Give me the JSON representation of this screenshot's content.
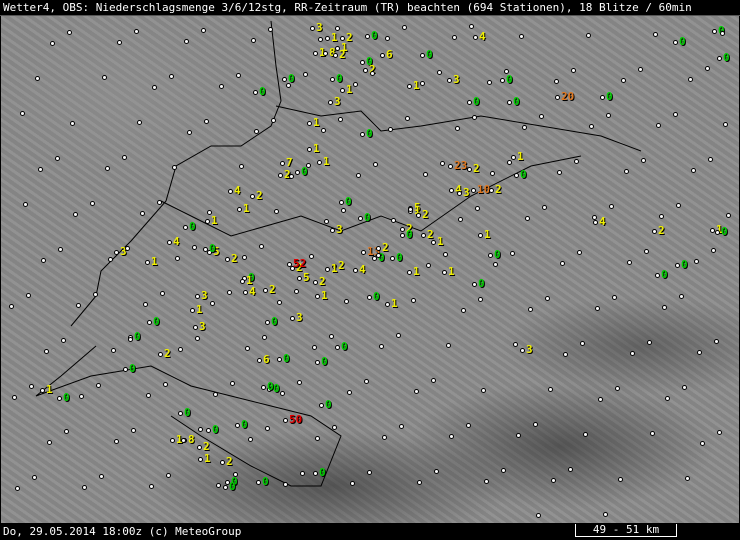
{
  "title": "Wetter4, OBS: Niederschlagsmenge 3/6/12stg, RR-Zeitraum (TR) beachten (694 Stationen), 18 Blitze / 60min",
  "footer": {
    "timestamp": "Do, 29.05.2014 18:00z (c) MeteoGroup",
    "scale": "49 - 51 km"
  },
  "colors": {
    "zero": "#00d000",
    "low": "#f0f000",
    "medium": "#e07820",
    "high": "#e00000",
    "terrain": "#8c8c8c",
    "border": "#000000"
  },
  "stations": [
    "3",
    "1",
    "2",
    "1",
    "0",
    "4",
    "0",
    "1",
    "8",
    "2",
    "6",
    "0",
    "0",
    "2",
    "0",
    "1",
    "0",
    "3",
    "0",
    "0",
    "3",
    "1",
    "0",
    "0",
    "20",
    "0",
    "0",
    "0",
    "7",
    "2",
    "1",
    "1",
    "0",
    "1",
    "0",
    "23",
    "2",
    "4",
    "3",
    "10",
    "2",
    "1",
    "0",
    "4",
    "2",
    "1",
    "0",
    "1",
    "5",
    "1",
    "2",
    "2",
    "0",
    "3",
    "0",
    "2",
    "1",
    "0",
    "3",
    "4",
    "1",
    "5",
    "0",
    "2",
    "2",
    "13",
    "2",
    "0",
    "4",
    "0",
    "1",
    "52",
    "5",
    "2",
    "1",
    "0",
    "3",
    "4",
    "2",
    "1",
    "2",
    "0",
    "1",
    "0",
    "3",
    "1",
    "3",
    "0",
    "0",
    "2",
    "0",
    "1",
    "0",
    "6",
    "0",
    "0",
    "0",
    "1",
    "1",
    "0",
    "0",
    "3",
    "1",
    "50",
    "0",
    "0",
    "0",
    "0",
    "0",
    "0",
    "8",
    "1",
    "2",
    "1",
    "2",
    "0",
    "0",
    "0",
    "0",
    "4",
    "2",
    "0",
    "0",
    "1",
    "0"
  ]
}
